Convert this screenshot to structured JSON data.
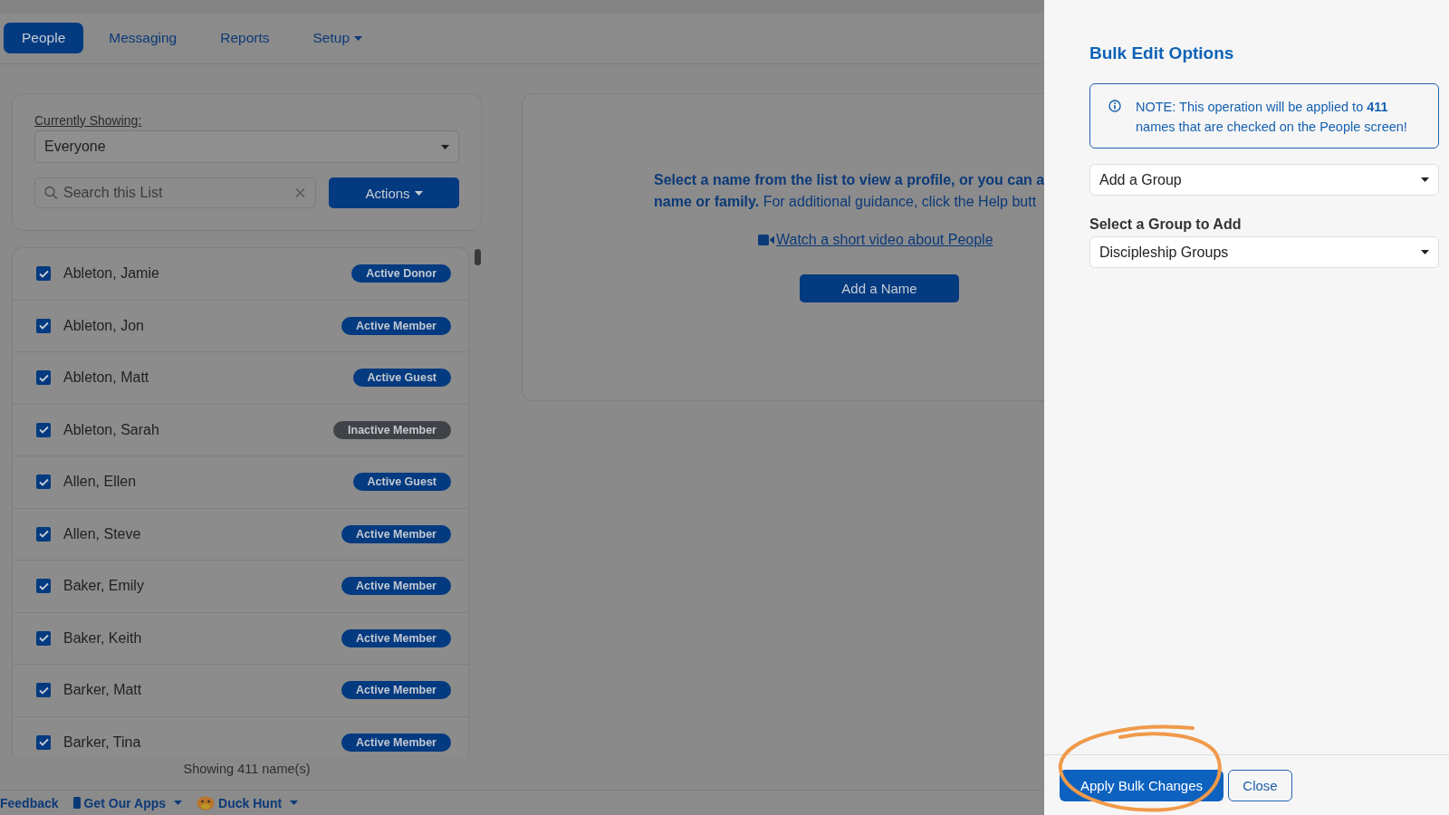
{
  "nav": {
    "tabs": [
      {
        "label": "People",
        "selected": true,
        "dropdown": false
      },
      {
        "label": "Messaging",
        "selected": false,
        "dropdown": false
      },
      {
        "label": "Reports",
        "selected": false,
        "dropdown": false
      },
      {
        "label": "Setup",
        "selected": false,
        "dropdown": true
      }
    ]
  },
  "filter": {
    "label": "Currently Showing:",
    "value": "Everyone",
    "search_placeholder": "Search this List",
    "actions_button": "Actions"
  },
  "people": [
    {
      "name": "Ableton, Jamie",
      "checked": true,
      "status": "Active Donor",
      "color": "#033a80"
    },
    {
      "name": "Ableton, Jon",
      "checked": true,
      "status": "Active Member",
      "color": "#033a80"
    },
    {
      "name": "Ableton, Matt",
      "checked": true,
      "status": "Active Guest",
      "color": "#033a80"
    },
    {
      "name": "Ableton, Sarah",
      "checked": true,
      "status": "Inactive Member",
      "color": "#3f4348"
    },
    {
      "name": "Allen, Ellen",
      "checked": true,
      "status": "Active Guest",
      "color": "#033a80"
    },
    {
      "name": "Allen, Steve",
      "checked": true,
      "status": "Active Member",
      "color": "#033a80"
    },
    {
      "name": "Baker, Emily",
      "checked": true,
      "status": "Active Member",
      "color": "#033a80"
    },
    {
      "name": "Baker, Keith",
      "checked": true,
      "status": "Active Member",
      "color": "#033a80"
    },
    {
      "name": "Barker, Matt",
      "checked": true,
      "status": "Active Member",
      "color": "#033a80"
    },
    {
      "name": "Barker, Tina",
      "checked": true,
      "status": "Active Member",
      "color": "#033a80"
    }
  ],
  "list_count": "Showing 411 name(s)",
  "intro": {
    "lines": [
      {
        "text": "Select a name from the list to view a profile, or you can a",
        "bold": true
      },
      {
        "text": "**name or family.** For additional guidance, click the Help butt",
        "bold": false
      }
    ],
    "video_link": "Watch a short video about People",
    "add_button": "Add a Name"
  },
  "footer": [
    {
      "label": "Feedback",
      "kind": "plain",
      "caret": false
    },
    {
      "label": "Get Our Apps",
      "kind": "phone",
      "caret": true
    },
    {
      "label": "Duck Hunt",
      "kind": "duck",
      "caret": true
    }
  ],
  "panel": {
    "title": "Bulk Edit Options",
    "note": "NOTE: This operation will be applied to **411** names that are checked on the People screen!",
    "action_select": "Add a Group",
    "group_label": "Select a Group to Add",
    "group_select": "Discipleship Groups",
    "apply_button": "Apply Bulk Changes",
    "close_button": "Close"
  }
}
